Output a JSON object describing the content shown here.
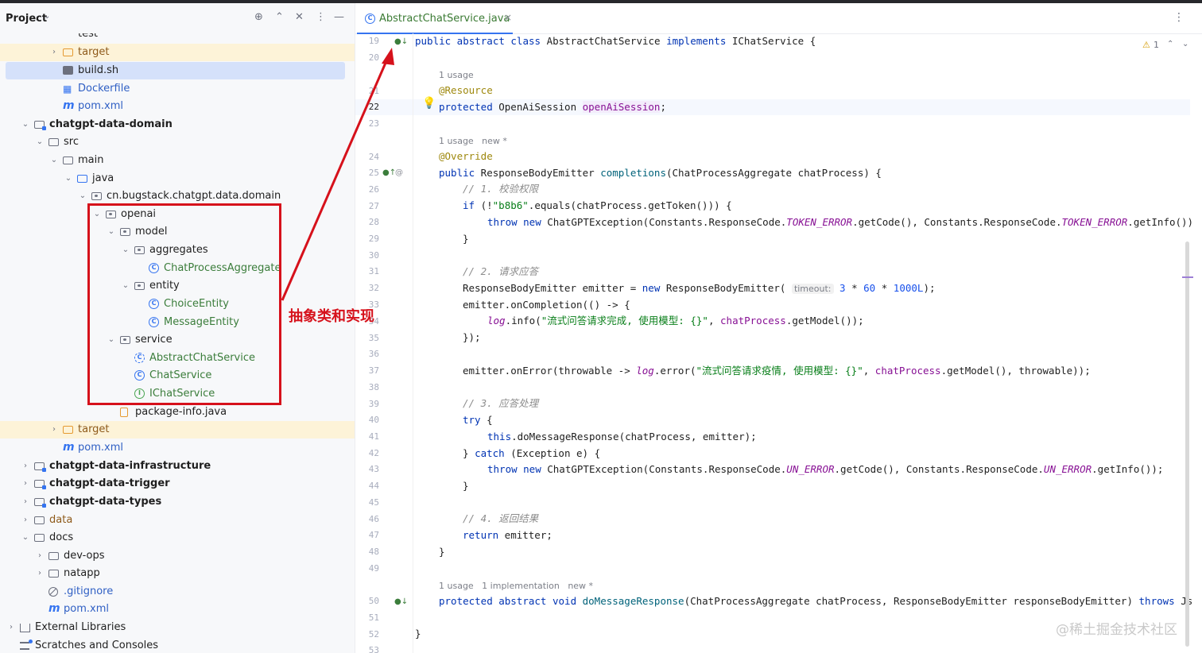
{
  "project": {
    "title": "Project",
    "tree": [
      {
        "label": "target",
        "icon": "folder-icon-orange",
        "arrow": "›",
        "style": "orange-t",
        "hl": "yellow"
      },
      {
        "label": "build.sh",
        "icon": "shell-script-icon",
        "arrow": "",
        "style": "",
        "hl": "sel"
      },
      {
        "label": "Dockerfile",
        "icon": "docker-icon",
        "arrow": "",
        "style": "blue-t",
        "hl": ""
      },
      {
        "label": "pom.xml",
        "icon": "maven-icon",
        "arrow": "",
        "style": "blue-t",
        "hl": ""
      },
      {
        "label": "chatgpt-data-domain",
        "icon": "module-icon",
        "arrow": "⌄",
        "style": "bold",
        "hl": ""
      },
      {
        "label": "src",
        "icon": "folder-icon",
        "arrow": "⌄",
        "style": "",
        "hl": ""
      },
      {
        "label": "main",
        "icon": "folder-icon",
        "arrow": "⌄",
        "style": "",
        "hl": ""
      },
      {
        "label": "java",
        "icon": "source-folder-icon",
        "arrow": "⌄",
        "style": "",
        "hl": ""
      },
      {
        "label": "cn.bugstack.chatgpt.data.domain",
        "icon": "package-icon",
        "arrow": "⌄",
        "style": "",
        "hl": ""
      },
      {
        "label": "openai",
        "icon": "package-icon",
        "arrow": "⌄",
        "style": "",
        "hl": ""
      },
      {
        "label": "model",
        "icon": "package-icon",
        "arrow": "⌄",
        "style": "",
        "hl": ""
      },
      {
        "label": "aggregates",
        "icon": "package-icon",
        "arrow": "⌄",
        "style": "",
        "hl": ""
      },
      {
        "label": "ChatProcessAggregate",
        "icon": "class-icon",
        "arrow": "",
        "style": "green-t",
        "hl": ""
      },
      {
        "label": "entity",
        "icon": "package-icon",
        "arrow": "⌄",
        "style": "",
        "hl": ""
      },
      {
        "label": "ChoiceEntity",
        "icon": "class-icon",
        "arrow": "",
        "style": "green-t",
        "hl": ""
      },
      {
        "label": "MessageEntity",
        "icon": "class-icon",
        "arrow": "",
        "style": "green-t",
        "hl": ""
      },
      {
        "label": "service",
        "icon": "package-icon",
        "arrow": "⌄",
        "style": "",
        "hl": ""
      },
      {
        "label": "AbstractChatService",
        "icon": "abstract-class-icon",
        "arrow": "",
        "style": "green-t",
        "hl": ""
      },
      {
        "label": "ChatService",
        "icon": "class-icon",
        "arrow": "",
        "style": "green-t",
        "hl": ""
      },
      {
        "label": "IChatService",
        "icon": "interface-icon",
        "arrow": "",
        "style": "green-t",
        "hl": ""
      },
      {
        "label": "package-info.java",
        "icon": "java-file-icon",
        "arrow": "",
        "style": "",
        "hl": ""
      },
      {
        "label": "target",
        "icon": "folder-icon-orange",
        "arrow": "›",
        "style": "orange-t",
        "hl": "yellow"
      },
      {
        "label": "pom.xml",
        "icon": "maven-icon",
        "arrow": "",
        "style": "blue-t",
        "hl": ""
      },
      {
        "label": "chatgpt-data-infrastructure",
        "icon": "module-icon",
        "arrow": "›",
        "style": "bold",
        "hl": ""
      },
      {
        "label": "chatgpt-data-trigger",
        "icon": "module-icon",
        "arrow": "›",
        "style": "bold",
        "hl": ""
      },
      {
        "label": "chatgpt-data-types",
        "icon": "module-icon",
        "arrow": "›",
        "style": "bold",
        "hl": ""
      },
      {
        "label": "data",
        "icon": "folder-icon",
        "arrow": "›",
        "style": "orange-t",
        "hl": ""
      },
      {
        "label": "docs",
        "icon": "folder-icon",
        "arrow": "⌄",
        "style": "",
        "hl": ""
      },
      {
        "label": "dev-ops",
        "icon": "folder-icon",
        "arrow": "›",
        "style": "",
        "hl": ""
      },
      {
        "label": "natapp",
        "icon": "folder-icon",
        "arrow": "›",
        "style": "",
        "hl": ""
      },
      {
        "label": ".gitignore",
        "icon": "gitignore-icon",
        "arrow": "",
        "style": "blue-t",
        "hl": ""
      },
      {
        "label": "pom.xml",
        "icon": "maven-icon",
        "arrow": "",
        "style": "blue-t",
        "hl": ""
      },
      {
        "label": "External Libraries",
        "icon": "library-icon",
        "arrow": "›",
        "style": "",
        "hl": ""
      },
      {
        "label": "Scratches and Consoles",
        "icon": "scratches-icon",
        "arrow": "",
        "style": "",
        "hl": ""
      }
    ],
    "partial_top_label": "test"
  },
  "editor": {
    "tab_label": "AbstractChatService.java",
    "tab_close": "×",
    "warning_count": "1",
    "hints": {
      "h1": "1 usage",
      "h2": "1 usage   new *",
      "h3": "1 usage   1 implementation   new *"
    },
    "inline_hint_timeout": "timeout:",
    "line_numbers": [
      "19",
      "20",
      "21",
      "22",
      "23",
      "24",
      "25",
      "26",
      "27",
      "28",
      "29",
      "30",
      "31",
      "32",
      "33",
      "34",
      "35",
      "36",
      "37",
      "38",
      "39",
      "40",
      "41",
      "42",
      "43",
      "44",
      "45",
      "46",
      "47",
      "48",
      "49",
      "50",
      "51",
      "52",
      "53"
    ],
    "code": {
      "l19": "public abstract class AbstractChatService implements IChatService {",
      "l21": "@Resource",
      "l22": "protected OpenAiSession openAiSession;",
      "l24": "@Override",
      "l25": "public ResponseBodyEmitter completions(ChatProcessAggregate chatProcess) {",
      "l26": "// 1. 校验权限",
      "l27": "if (!\"b8b6\".equals(chatProcess.getToken())) {",
      "l28a": "throw new ChatGPTException(Constants.ResponseCode.",
      "l28b": "TOKEN_ERROR",
      "l28c": ".getCode(), Constants.ResponseCode.",
      "l28d": ".getInfo())",
      "l29": "}",
      "l31": "// 2. 请求应答",
      "l32a": "ResponseBodyEmitter emitter = ",
      "l32b": "new",
      "l32c": " ResponseBodyEmitter(",
      "l32d": " 3 * 60 * 1000L);",
      "l33": "emitter.onCompletion(() -> {",
      "l34a": "log",
      "l34b": ".info(",
      "l34c": "\"流式问答请求完成, 使用模型: {}\"",
      "l34d": ", ",
      "l34e": "chatProcess",
      "l34f": ".getModel());",
      "l35": "});",
      "l37a": "emitter.onError(throwable -> ",
      "l37c": "\"流式问答请求疫情, 使用模型: {}\"",
      "l37d": ".getModel(), throwable));",
      "l39": "// 3. 应答处理",
      "l40": "try {",
      "l41a": "this",
      "l41b": ".doMessageResponse(chatProcess, emitter);",
      "l42": "} catch (Exception e) {",
      "l43b": "UN_ERROR",
      "l43d": ".getInfo());",
      "l44": "}",
      "l46": "// 4. 返回结果",
      "l47": "return emitter;",
      "l48": "}",
      "l50": "protected abstract void doMessageResponse(ChatProcessAggregate chatProcess, ResponseBodyEmitter responseBodyEmitter) throws Js",
      "l52": "}"
    }
  },
  "annotation": {
    "label": "抽象类和实现",
    "color": "#d6111b"
  },
  "watermark": "@稀土掘金技术社区"
}
